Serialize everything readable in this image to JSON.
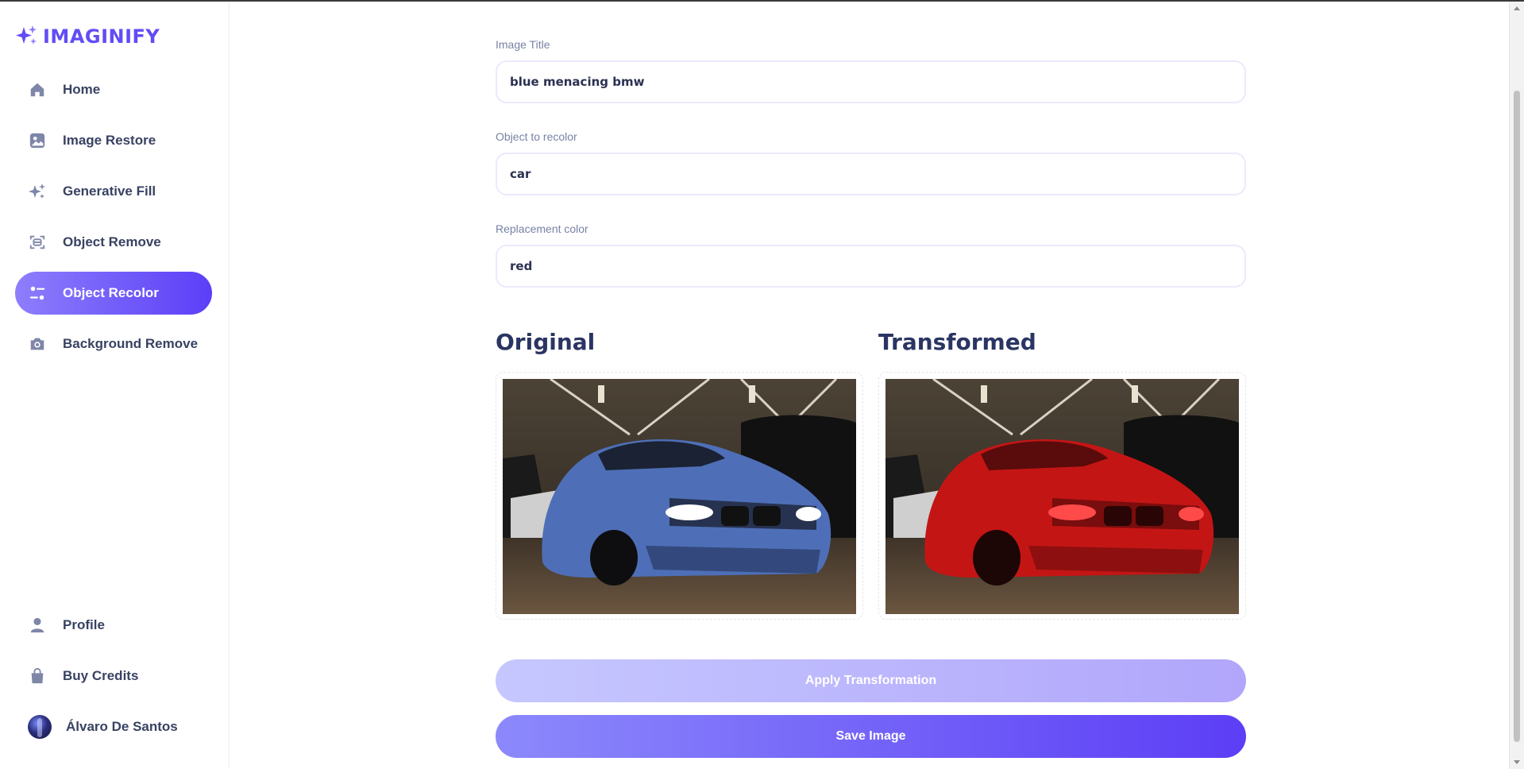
{
  "app": {
    "logo_text": "IMAGINIFY",
    "accent": "#624cf5"
  },
  "sidebar": {
    "items": [
      {
        "label": "Home",
        "icon": "home-icon"
      },
      {
        "label": "Image Restore",
        "icon": "image-icon"
      },
      {
        "label": "Generative Fill",
        "icon": "sparkle-icon"
      },
      {
        "label": "Object Remove",
        "icon": "scan-icon"
      },
      {
        "label": "Object Recolor",
        "icon": "filter-icon",
        "active": true
      },
      {
        "label": "Background Remove",
        "icon": "camera-icon"
      }
    ],
    "bottom": [
      {
        "label": "Profile",
        "icon": "user-icon"
      },
      {
        "label": "Buy Credits",
        "icon": "bag-icon"
      }
    ],
    "user": {
      "name": "Álvaro De Santos"
    }
  },
  "form": {
    "title_label": "Image Title",
    "title_value": "blue menacing bmw",
    "object_label": "Object to recolor",
    "object_value": "car",
    "color_label": "Replacement color",
    "color_value": "red"
  },
  "panels": {
    "original": "Original",
    "transformed": "Transformed"
  },
  "buttons": {
    "apply": "Apply Transformation",
    "save": "Save Image"
  }
}
